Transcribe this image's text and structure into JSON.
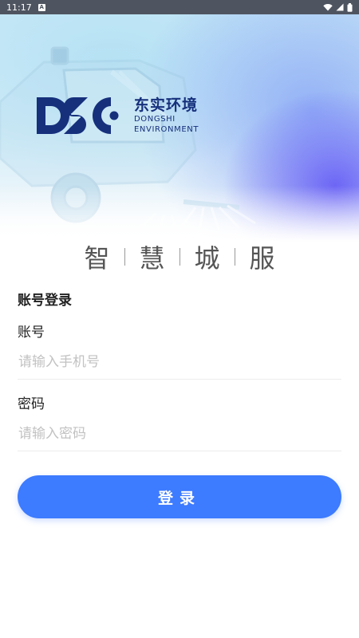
{
  "status_bar": {
    "time": "11:17",
    "app_icon_letter": "A",
    "icons": [
      "wifi-icon",
      "signal-icon",
      "battery-icon"
    ]
  },
  "brand": {
    "name_cn": "东实环境",
    "name_en_line1": "DONGSHI",
    "name_en_line2": "ENVIRONMENT",
    "color": "#16307c"
  },
  "slogan": {
    "chars": [
      "智",
      "慧",
      "城",
      "服"
    ]
  },
  "login": {
    "title": "账号登录",
    "account_label": "账号",
    "account_placeholder": "请输入手机号",
    "account_value": "",
    "password_label": "密码",
    "password_placeholder": "请输入密码",
    "password_value": "",
    "submit_label": "登录",
    "accent_color": "#3d7bff"
  }
}
